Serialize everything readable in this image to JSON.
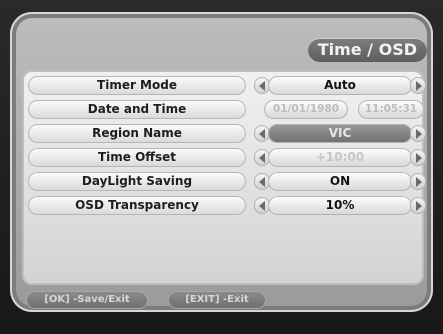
{
  "header": {
    "title": "Time / OSD"
  },
  "menu": {
    "rows": [
      {
        "label": "Timer Mode",
        "value": "Auto"
      },
      {
        "label": "Date and Time",
        "date": "01/01/1980",
        "time": "11:05:31"
      },
      {
        "label": "Region Name",
        "value": "VIC"
      },
      {
        "label": "Time Offset",
        "value": "+10:00"
      },
      {
        "label": "DayLight Saving",
        "value": "ON"
      },
      {
        "label": "OSD Transparency",
        "value": "10%"
      }
    ]
  },
  "footer": {
    "ok_hint": "[OK] -Save/Exit",
    "exit_hint": "[EXIT] -Exit"
  }
}
